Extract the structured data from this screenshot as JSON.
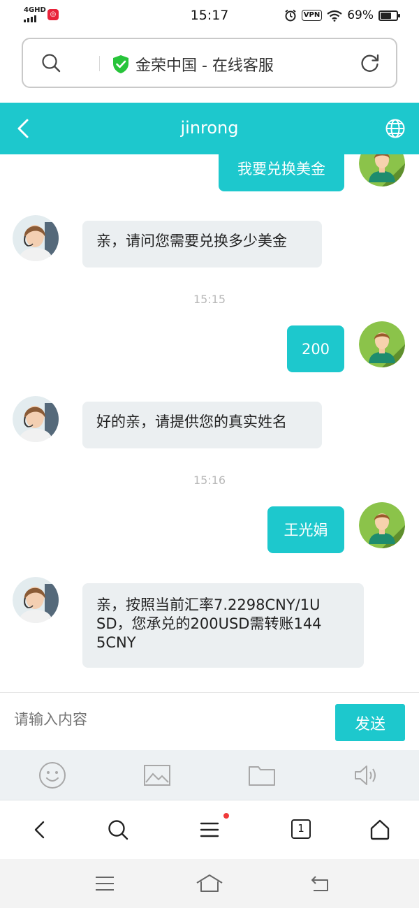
{
  "status_bar": {
    "network": "4GHD",
    "time": "15:17",
    "vpn": "VPN",
    "battery_percent": "69%",
    "battery_level": 0.69
  },
  "address_bar": {
    "title": "金荣中国 - 在线客服",
    "icons": [
      "search-icon",
      "shield-check-icon",
      "reload-icon"
    ]
  },
  "header": {
    "title": "jinrong",
    "icons": [
      "back-icon",
      "globe-icon"
    ]
  },
  "messages": [
    {
      "side": "out",
      "text": "我要兑换美金"
    },
    {
      "side": "in",
      "text": "亲，请问您需要兑换多少美金"
    },
    {
      "type": "time",
      "text": "15:15"
    },
    {
      "side": "out",
      "text": "200"
    },
    {
      "side": "in",
      "text": "好的亲，请提供您的真实姓名"
    },
    {
      "type": "time",
      "text": "15:16"
    },
    {
      "side": "out",
      "text": "王光娟"
    },
    {
      "side": "in",
      "lines": [
        "亲，按照当前汇率7.2298CNY/1U",
        "SD，您承兑的200USD需转账144",
        "5CNY"
      ]
    }
  ],
  "input": {
    "placeholder": "请输入内容",
    "send_label": "发送"
  },
  "toolbar": {
    "icons": [
      "emoji-icon",
      "image-icon",
      "folder-icon",
      "speaker-icon"
    ]
  },
  "browser_nav": {
    "tabs_count": "1",
    "icons": [
      "back-icon",
      "search-icon",
      "menu-icon",
      "tabs-icon",
      "home-icon"
    ]
  },
  "system_nav": {
    "icons": [
      "menu-icon",
      "home-icon",
      "back-icon"
    ]
  },
  "colors": {
    "accent": "#1dc8cd",
    "incoming_bubble": "#ebeff1",
    "notification_dot": "#f03a3a"
  }
}
